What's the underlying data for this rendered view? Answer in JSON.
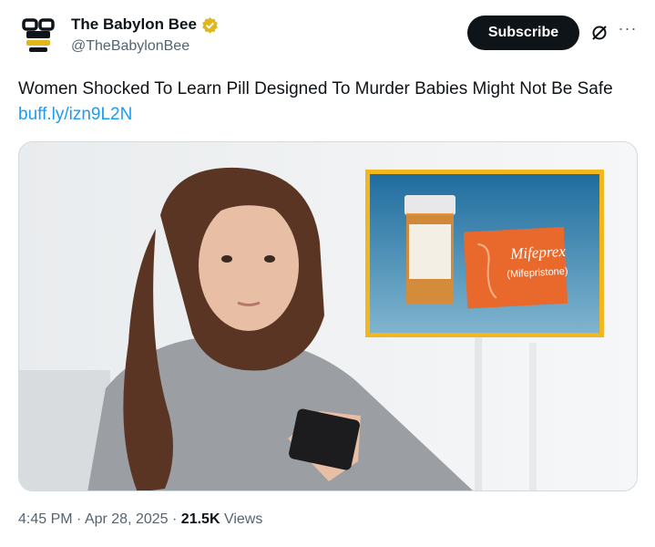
{
  "author": {
    "name": "The Babylon Bee",
    "handle": "@TheBabylonBee",
    "verified_badge": "gold-verified-icon",
    "avatar_icon": "bee-logo-icon"
  },
  "actions": {
    "subscribe_label": "Subscribe",
    "grok_icon": "grok-icon",
    "more_icon": "more-options-icon",
    "more_label": "···"
  },
  "tweet": {
    "text": "Women Shocked To Learn Pill Designed To Murder Babies Might Not Be Safe ",
    "link_text": "buff.ly/izn9L2N"
  },
  "media": {
    "description_icon": "article-thumbnail-image",
    "inset": {
      "box_brand": "Mifeprex",
      "box_generic": "(Mifepristone)"
    }
  },
  "meta": {
    "time": "4:45 PM",
    "separator": "·",
    "date": "Apr 28, 2025",
    "views_count": "21.5K",
    "views_label": "Views"
  },
  "colors": {
    "text": "#0f1419",
    "secondary": "#536471",
    "link": "#1d9bf0",
    "verified_gold": "#e2b719",
    "inset_border": "#f2b61f",
    "box_orange": "#e8692b"
  }
}
